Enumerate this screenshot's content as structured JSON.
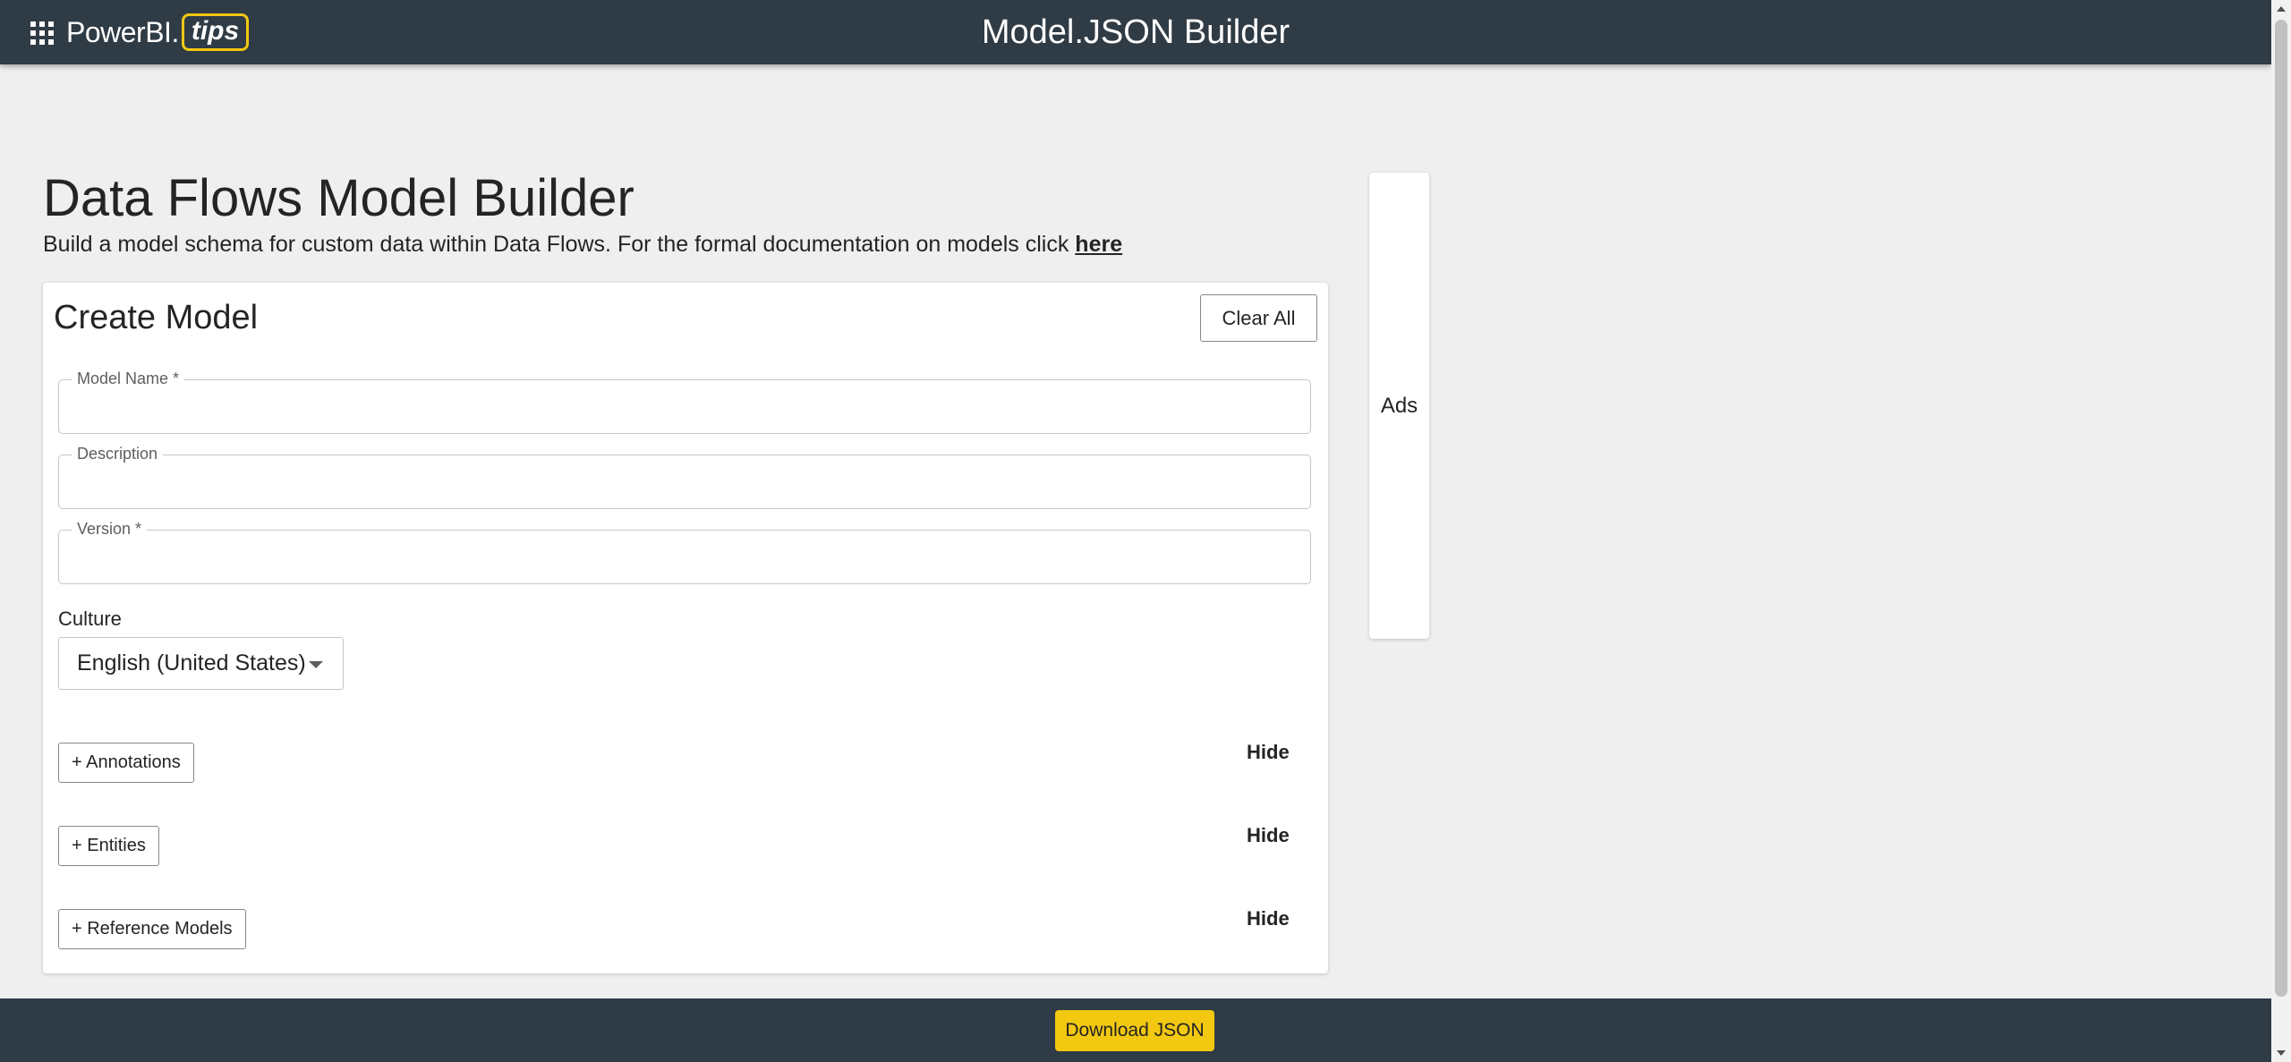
{
  "header": {
    "logo_text": "PowerBI.",
    "logo_tips": "tips",
    "title": "Model.JSON Builder"
  },
  "intro": {
    "heading": "Data Flows Model Builder",
    "description": "Build a model schema for custom data within Data Flows. For the formal documentation on models click ",
    "link_text": "here"
  },
  "form": {
    "title": "Create Model",
    "clear_label": "Clear All",
    "fields": {
      "model_name": {
        "label": "Model Name *",
        "value": ""
      },
      "description": {
        "label": "Description",
        "value": ""
      },
      "version": {
        "label": "Version *",
        "value": ""
      }
    },
    "culture": {
      "label": "Culture",
      "selected": "English (United States)"
    },
    "sections": [
      {
        "add_label": "+ Annotations",
        "hide_label": "Hide"
      },
      {
        "add_label": "+ Entities",
        "hide_label": "Hide"
      },
      {
        "add_label": "+ Reference Models",
        "hide_label": "Hide"
      }
    ]
  },
  "ads": {
    "label": "Ads"
  },
  "footer": {
    "download_label": "Download JSON"
  },
  "colors": {
    "header_bg": "#2f3b45",
    "accent_yellow": "#f2c811",
    "page_bg": "#efefef"
  }
}
